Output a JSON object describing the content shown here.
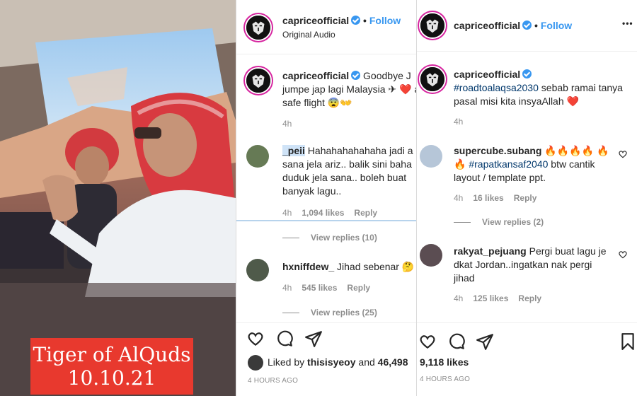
{
  "video": {
    "caption_line1": "Tiger of AlQuds",
    "caption_line2": "10.10.21"
  },
  "panel1": {
    "header": {
      "username": "capriceofficial",
      "separator": "•",
      "follow": "Follow",
      "audio": "Original Audio"
    },
    "caption": {
      "username": "capriceofficial",
      "text": "Goodbye J jumpe jap lagi Malaysia ✈ ❤️ a safe flight 😨👐",
      "time": "4h"
    },
    "comments": [
      {
        "username": "_peii",
        "text": "Hahahahahahaha jadi a sana jela ariz.. balik sini baha duduk jela sana.. boleh buat banyak lagu..",
        "time": "4h",
        "likes": "1,094 likes",
        "reply": "Reply",
        "view_replies": "View replies (10)"
      },
      {
        "username": "hxniffdew_",
        "text": "Jihad sebenar 🤔",
        "time": "4h",
        "likes": "545 likes",
        "reply": "Reply",
        "view_replies": "View replies (25)"
      }
    ],
    "liked_by": {
      "prefix": "Liked by",
      "user": "thisisyeoy",
      "and": "and",
      "count": "46,498"
    },
    "timestamp": "4 HOURS AGO"
  },
  "panel2": {
    "header": {
      "username": "capriceofficial",
      "separator": "•",
      "follow": "Follow",
      "more": "•••"
    },
    "caption": {
      "username": "capriceofficial",
      "hashtag": "#roadtoalaqsa2030",
      "text": " sebab ramai tanya pasal misi kita insyaAllah ❤️",
      "time": "4h"
    },
    "comments": [
      {
        "username": "supercube.subang",
        "emoji_line": "🔥🔥🔥🔥",
        "text_emoji": "🔥🔥",
        "hashtag": "#rapatkansaf2040",
        "text": " btw cantik layout / template ppt.",
        "time": "4h",
        "likes": "16 likes",
        "reply": "Reply",
        "view_replies": "View replies (2)"
      },
      {
        "username": "rakyat_pejuang",
        "text": "Pergi buat lagu je dkat Jordan..ingatkan nak pergi jihad",
        "time": "4h",
        "likes": "125 likes",
        "reply": "Reply"
      }
    ],
    "likes": "9,118 likes",
    "timestamp": "4 HOURS AGO"
  }
}
